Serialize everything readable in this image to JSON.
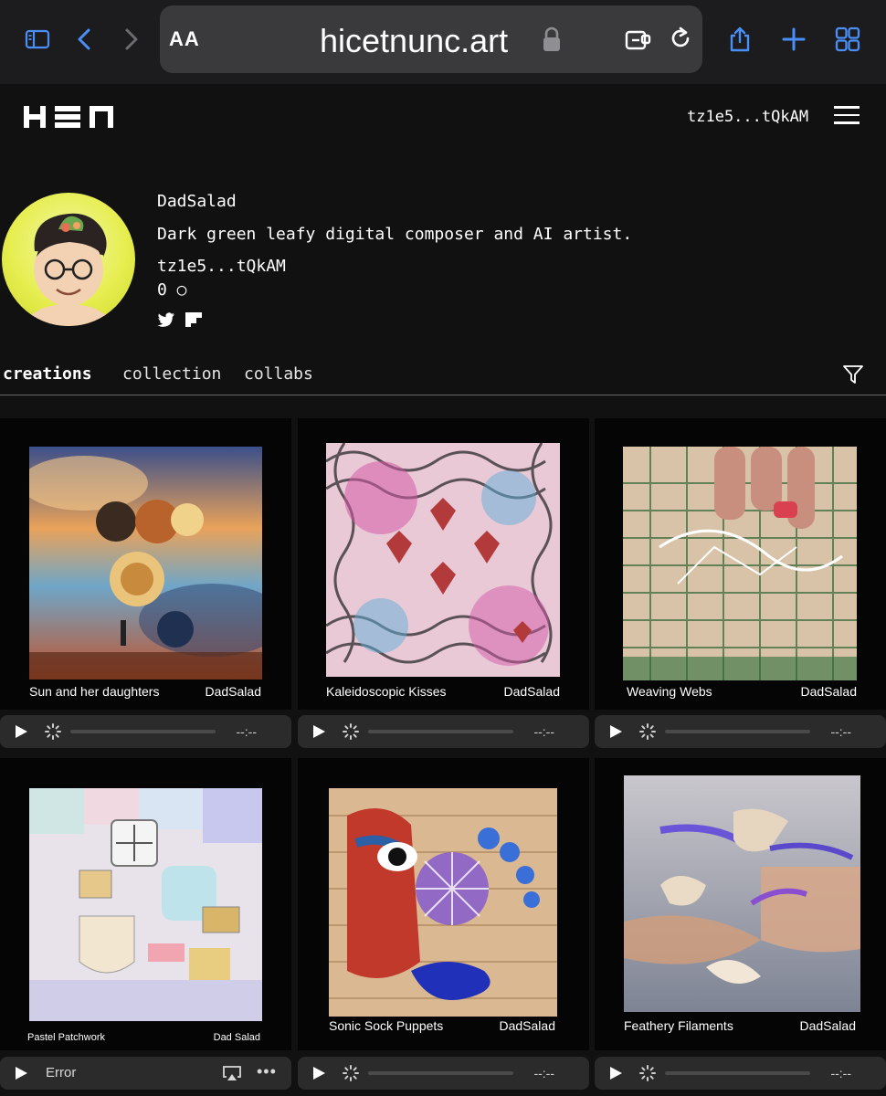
{
  "browser": {
    "text_size_label": "AA",
    "url": "hicetnunc.art"
  },
  "site": {
    "wallet_short": "tz1e5...tQkAM"
  },
  "profile": {
    "name": "DadSalad",
    "bio": "Dark green leafy digital composer and AI artist.",
    "address": "tz1e5...tQkAM",
    "count": "0 ○"
  },
  "tabs": [
    "creations",
    "collection",
    "collabs"
  ],
  "cards": [
    {
      "title": "Sun and her daughters",
      "artist": "DadSalad",
      "player": {
        "time": "--:--"
      }
    },
    {
      "title": "Kaleidoscopic Kisses",
      "artist": "DadSalad",
      "player": {
        "time": "--:--"
      }
    },
    {
      "title": "Weaving Webs",
      "artist": "DadSalad",
      "player": {
        "time": "--:--"
      }
    },
    {
      "title": "Pastel Patchwork",
      "artist": "Dad Salad",
      "player": {
        "status": "Error"
      }
    },
    {
      "title": "Sonic Sock Puppets",
      "artist": "DadSalad",
      "player": {
        "time": "--:--"
      }
    },
    {
      "title": "Feathery Filaments",
      "artist": "DadSalad",
      "player": {
        "time": "--:--"
      }
    }
  ],
  "colors": {
    "toolbar_bg": "#1c1c1e",
    "address_bg": "#3a3a3c",
    "accent_blue": "#4a8ff7",
    "page_bg": "#111111",
    "card_bg": "#050505",
    "player_bg": "#2b2b2b"
  }
}
